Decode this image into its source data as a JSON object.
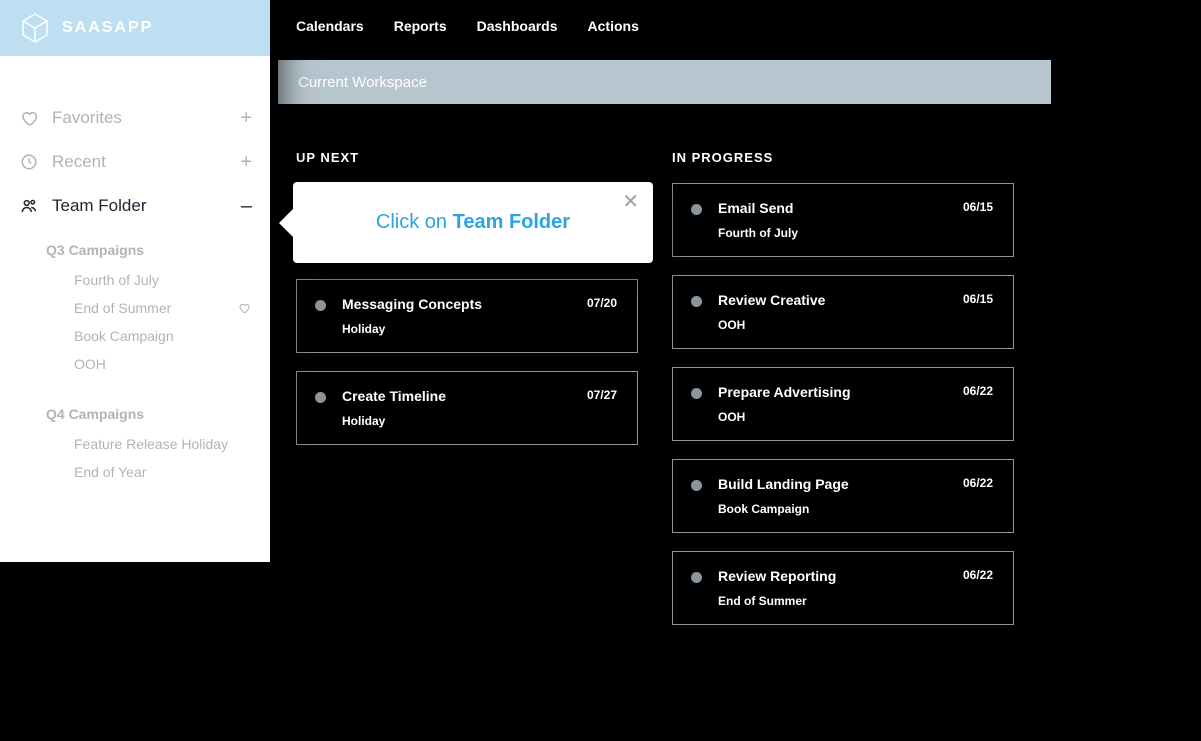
{
  "app": {
    "name": "SAASAPP"
  },
  "nav": {
    "items": [
      "Calendars",
      "Reports",
      "Dashboards",
      "Actions"
    ]
  },
  "banner": {
    "title": "Current Workspace"
  },
  "sidebar": {
    "favorites": {
      "label": "Favorites",
      "trail": "+"
    },
    "recent": {
      "label": "Recent",
      "trail": "+"
    },
    "team": {
      "label": "Team Folder",
      "trail": "–"
    },
    "groups": [
      {
        "header": "Q3 Campaigns",
        "items": [
          {
            "label": "Fourth of July",
            "fav": false
          },
          {
            "label": "End of Summer",
            "fav": true
          },
          {
            "label": "Book Campaign",
            "fav": false
          },
          {
            "label": "OOH",
            "fav": false
          }
        ]
      },
      {
        "header": "Q4 Campaigns",
        "items": [
          {
            "label": "Feature Release Holiday",
            "fav": false
          },
          {
            "label": "End of Year",
            "fav": false
          }
        ]
      }
    ]
  },
  "tooltip": {
    "prefix": "Click on ",
    "emphasis": "Team Folder"
  },
  "columns": {
    "upnext": {
      "title": "UP NEXT",
      "cards": [
        {
          "title": "",
          "sub": "",
          "date": ""
        },
        {
          "title": "Messaging Concepts",
          "sub": "Holiday",
          "date": "07/20"
        },
        {
          "title": "Create Timeline",
          "sub": "Holiday",
          "date": "07/27"
        }
      ]
    },
    "inprogress": {
      "title": "IN PROGRESS",
      "cards": [
        {
          "title": "Email Send",
          "sub": "Fourth of July",
          "date": "06/15"
        },
        {
          "title": "Review Creative",
          "sub": "OOH",
          "date": "06/15"
        },
        {
          "title": "Prepare Advertising",
          "sub": "OOH",
          "date": "06/22"
        },
        {
          "title": "Build Landing Page",
          "sub": "Book Campaign",
          "date": "06/22"
        },
        {
          "title": "Review Reporting",
          "sub": "End of Summer",
          "date": "06/22"
        }
      ]
    }
  }
}
